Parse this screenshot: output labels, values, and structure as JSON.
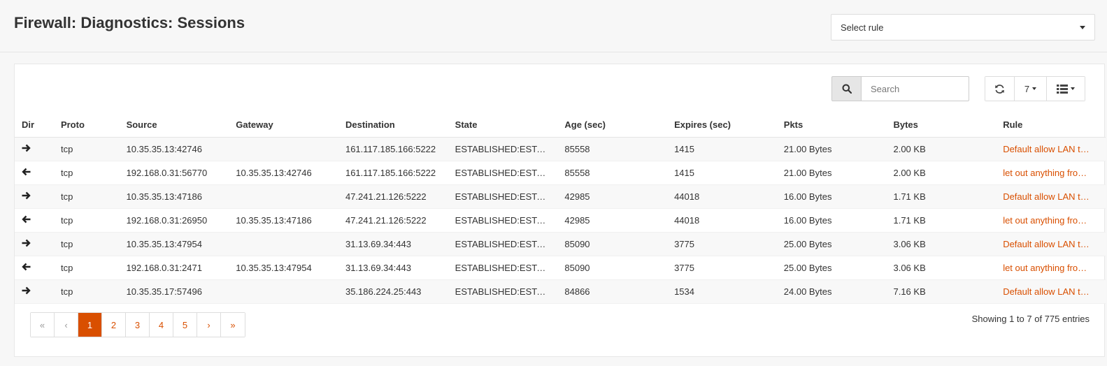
{
  "header": {
    "title": "Firewall: Diagnostics: Sessions",
    "rule_select": {
      "label": "Select rule"
    }
  },
  "toolbar": {
    "search_placeholder": "Search",
    "refresh_icon": "refresh-icon",
    "page_size": "7",
    "columns_icon": "list-icon"
  },
  "table": {
    "columns": [
      "Dir",
      "Proto",
      "Source",
      "Gateway",
      "Destination",
      "State",
      "Age (sec)",
      "Expires (sec)",
      "Pkts",
      "Bytes",
      "Rule"
    ],
    "rows": [
      {
        "dir": "out",
        "proto": "tcp",
        "source": "10.35.35.13:42746",
        "gateway": "",
        "destination": "161.117.185.166:5222",
        "state": "ESTABLISHED:ESTA…",
        "age": "85558",
        "expires": "1415",
        "pkts": "21.00 Bytes",
        "bytes": "2.00 KB",
        "rule": "Default allow LAN t…"
      },
      {
        "dir": "in",
        "proto": "tcp",
        "source": "192.168.0.31:56770",
        "gateway": "10.35.35.13:42746",
        "destination": "161.117.185.166:5222",
        "state": "ESTABLISHED:ESTA…",
        "age": "85558",
        "expires": "1415",
        "pkts": "21.00 Bytes",
        "bytes": "2.00 KB",
        "rule": "let out anything fro…"
      },
      {
        "dir": "out",
        "proto": "tcp",
        "source": "10.35.35.13:47186",
        "gateway": "",
        "destination": "47.241.21.126:5222",
        "state": "ESTABLISHED:ESTA…",
        "age": "42985",
        "expires": "44018",
        "pkts": "16.00 Bytes",
        "bytes": "1.71 KB",
        "rule": "Default allow LAN t…"
      },
      {
        "dir": "in",
        "proto": "tcp",
        "source": "192.168.0.31:26950",
        "gateway": "10.35.35.13:47186",
        "destination": "47.241.21.126:5222",
        "state": "ESTABLISHED:ESTA…",
        "age": "42985",
        "expires": "44018",
        "pkts": "16.00 Bytes",
        "bytes": "1.71 KB",
        "rule": "let out anything fro…"
      },
      {
        "dir": "out",
        "proto": "tcp",
        "source": "10.35.35.13:47954",
        "gateway": "",
        "destination": "31.13.69.34:443",
        "state": "ESTABLISHED:ESTA…",
        "age": "85090",
        "expires": "3775",
        "pkts": "25.00 Bytes",
        "bytes": "3.06 KB",
        "rule": "Default allow LAN t…"
      },
      {
        "dir": "in",
        "proto": "tcp",
        "source": "192.168.0.31:2471",
        "gateway": "10.35.35.13:47954",
        "destination": "31.13.69.34:443",
        "state": "ESTABLISHED:ESTA…",
        "age": "85090",
        "expires": "3775",
        "pkts": "25.00 Bytes",
        "bytes": "3.06 KB",
        "rule": "let out anything fro…"
      },
      {
        "dir": "out",
        "proto": "tcp",
        "source": "10.35.35.17:57496",
        "gateway": "",
        "destination": "35.186.224.25:443",
        "state": "ESTABLISHED:ESTA…",
        "age": "84866",
        "expires": "1534",
        "pkts": "24.00 Bytes",
        "bytes": "7.16 KB",
        "rule": "Default allow LAN t…"
      }
    ]
  },
  "pagination": {
    "first": "«",
    "prev": "‹",
    "pages": [
      "1",
      "2",
      "3",
      "4",
      "5"
    ],
    "active_page": "1",
    "next": "›",
    "last": "»",
    "info": "Showing 1 to 7 of 775 entries"
  },
  "colors": {
    "accent": "#d94f00",
    "row_alt": "#f8f8f8"
  }
}
